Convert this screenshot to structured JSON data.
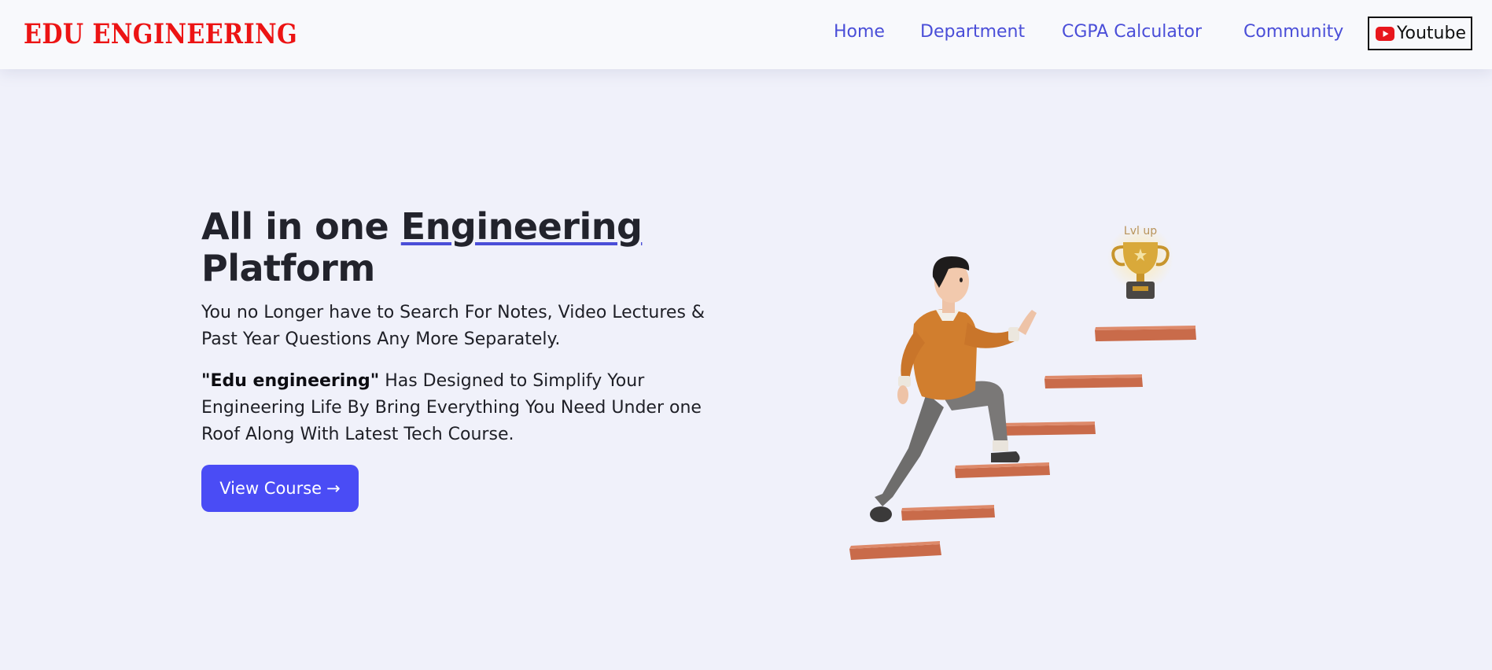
{
  "header": {
    "brand": "EDU ENGINEERING",
    "nav": [
      {
        "label": "Home"
      },
      {
        "label": "Department"
      },
      {
        "label": "CGPA Calculator"
      },
      {
        "label": "Community"
      }
    ],
    "youtube": {
      "label": "Youtube",
      "icon": "youtube-icon"
    }
  },
  "hero": {
    "title_part1": "All in one ",
    "title_highlight": "Engineering",
    "title_part2": "Platform",
    "subtitle": "You no Longer have to Search For Notes, Video Lectures & Past Year Questions Any More Separately.",
    "desc_bold": "\"Edu engineering\"",
    "desc_rest": " Has Designed to Simplify Your Engineering Life By Bring Everything You Need Under one Roof Along With Latest Tech Course.",
    "cta_label": "View Course",
    "cta_arrow": "→",
    "illustration_text": "Lvl up"
  },
  "colors": {
    "brand": "#ec1414",
    "nav_link": "#4a4ed8",
    "cta_bg": "#4a4cf5",
    "background": "#f0f1fa",
    "header_bg": "#f8f9fc"
  }
}
